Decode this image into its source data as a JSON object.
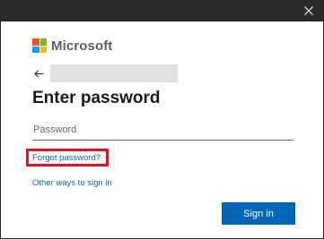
{
  "brand": {
    "name": "Microsoft",
    "colors": [
      "#f25022",
      "#7fba00",
      "#00a4ef",
      "#ffb900"
    ]
  },
  "titlebar": {
    "close_icon": "close-icon"
  },
  "identity": {
    "back_icon": "back-arrow-icon"
  },
  "page": {
    "title": "Enter password"
  },
  "password": {
    "placeholder": "Password",
    "value": ""
  },
  "links": {
    "forgot_password": "Forgot password?",
    "other_ways": "Other ways to sign in"
  },
  "actions": {
    "sign_in_label": "Sign in"
  },
  "colors": {
    "accent": "#0067b8",
    "highlight": "#e81123",
    "titlebar": "#2b2b2b"
  }
}
